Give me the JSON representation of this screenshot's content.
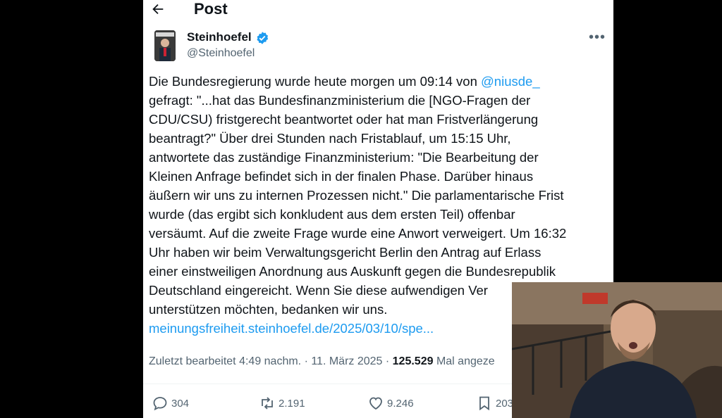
{
  "header": {
    "title": "Post"
  },
  "author": {
    "name": "Steinhoefel",
    "handle": "@Steinhoefel"
  },
  "tweet": {
    "lines": [
      [
        {
          "t": "Die Bundesregierung wurde heute morgen um 09:14 von "
        },
        {
          "t": "@niusde_",
          "link": true
        }
      ],
      [
        {
          "t": "gefragt: \"...hat das Bundesfinanzministerium die [NGO-Fragen der"
        }
      ],
      [
        {
          "t": "CDU/CSU) fristgerecht beantwortet oder hat man Fristverlängerung"
        }
      ],
      [
        {
          "t": "beantragt?\" Über drei Stunden nach Fristablauf, um 15:15 Uhr,"
        }
      ],
      [
        {
          "t": "antwortete das zuständige Finanzministerium: \"Die Bearbeitung der"
        }
      ],
      [
        {
          "t": "Kleinen Anfrage befindet sich in der finalen Phase. Darüber hinaus"
        }
      ],
      [
        {
          "t": "äußern wir uns zu internen Prozessen nicht.\" Die parlamentarische Frist"
        }
      ],
      [
        {
          "t": "wurde (das ergibt sich konkludent aus dem ersten Teil) offenbar"
        }
      ],
      [
        {
          "t": "versäumt. Auf die zweite Frage wurde eine Anwort verweigert. Um 16:32"
        }
      ],
      [
        {
          "t": "Uhr haben wir beim Verwaltungsgericht Berlin den Antrag auf Erlass"
        }
      ],
      [
        {
          "t": "einer einstweiligen Anordnung aus Auskunft gegen die Bundesrepublik"
        }
      ],
      [
        {
          "t": "Deutschland eingereicht. Wenn Sie diese aufwendigen Ver"
        }
      ],
      [
        {
          "t": "unterstützen möchten, bedanken wir uns."
        }
      ],
      [
        {
          "t": "meinungsfreiheit.steinhoefel.de/2025/03/10/spe...",
          "link": true
        }
      ]
    ]
  },
  "meta": {
    "edited": "Zuletzt bearbeitet 4:49 nachm. · 11. März 2025 · ",
    "views": "125.529",
    "views_label": " Mal angeze"
  },
  "actions": {
    "replies": "304",
    "reposts": "2.191",
    "likes": "9.246",
    "bookmarks": "203"
  },
  "colors": {
    "link": "#1d9bf0",
    "verified": "#1d9bf0",
    "text": "#0f1419",
    "muted": "#536471"
  }
}
